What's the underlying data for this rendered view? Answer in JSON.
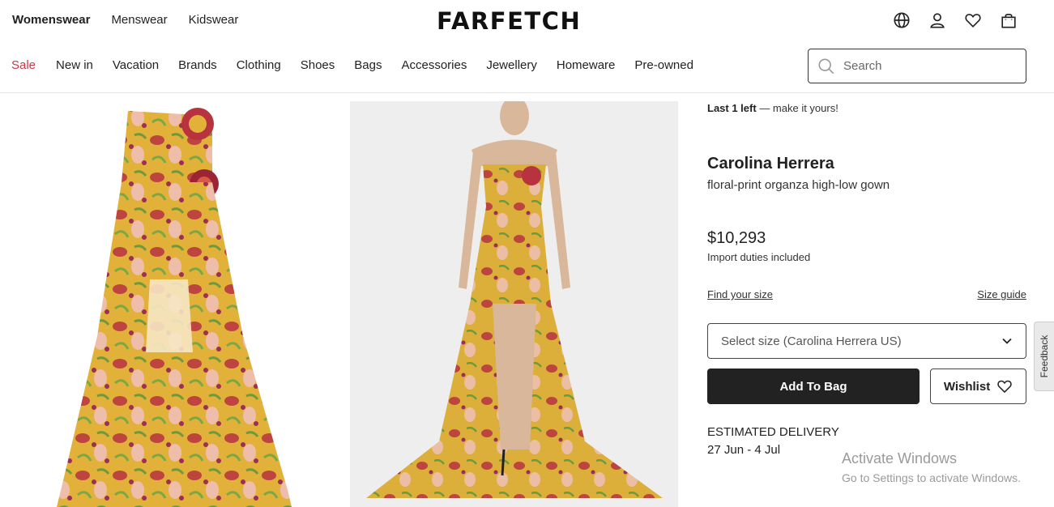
{
  "header": {
    "gender_tabs": [
      "Womenswear",
      "Menswear",
      "Kidswear"
    ],
    "logo": "FARFETCH",
    "icons": [
      "globe-icon",
      "account-icon",
      "wishlist-heart-icon",
      "shopping-bag-icon"
    ]
  },
  "nav": {
    "categories": [
      "Sale",
      "New in",
      "Vacation",
      "Brands",
      "Clothing",
      "Shoes",
      "Bags",
      "Accessories",
      "Jewellery",
      "Homeware",
      "Pre-owned"
    ],
    "sale_color": "#c23b4a"
  },
  "search": {
    "placeholder": "Search",
    "value": ""
  },
  "product": {
    "stock_bold": "Last 1 left",
    "stock_rest": "— make it yours!",
    "brand": "Carolina Herrera",
    "name": "floral-print organza high-low gown",
    "price": "$10,293",
    "duties": "Import duties included",
    "find_size": "Find your size",
    "size_guide": "Size guide",
    "size_select": "Select size (Carolina Herrera US)",
    "add_to_bag": "Add To Bag",
    "wishlist": "Wishlist",
    "delivery_label": "ESTIMATED DELIVERY",
    "delivery_dates": "27 Jun - 4 Jul"
  },
  "feedback": "Feedback",
  "watermark": {
    "line1": "Activate Windows",
    "line2": "Go to Settings to activate Windows."
  },
  "colors": {
    "primary": "#222222",
    "sale": "#c23b4a",
    "gown_yellow": "#e2b13a",
    "gown_red": "#b8323f"
  }
}
